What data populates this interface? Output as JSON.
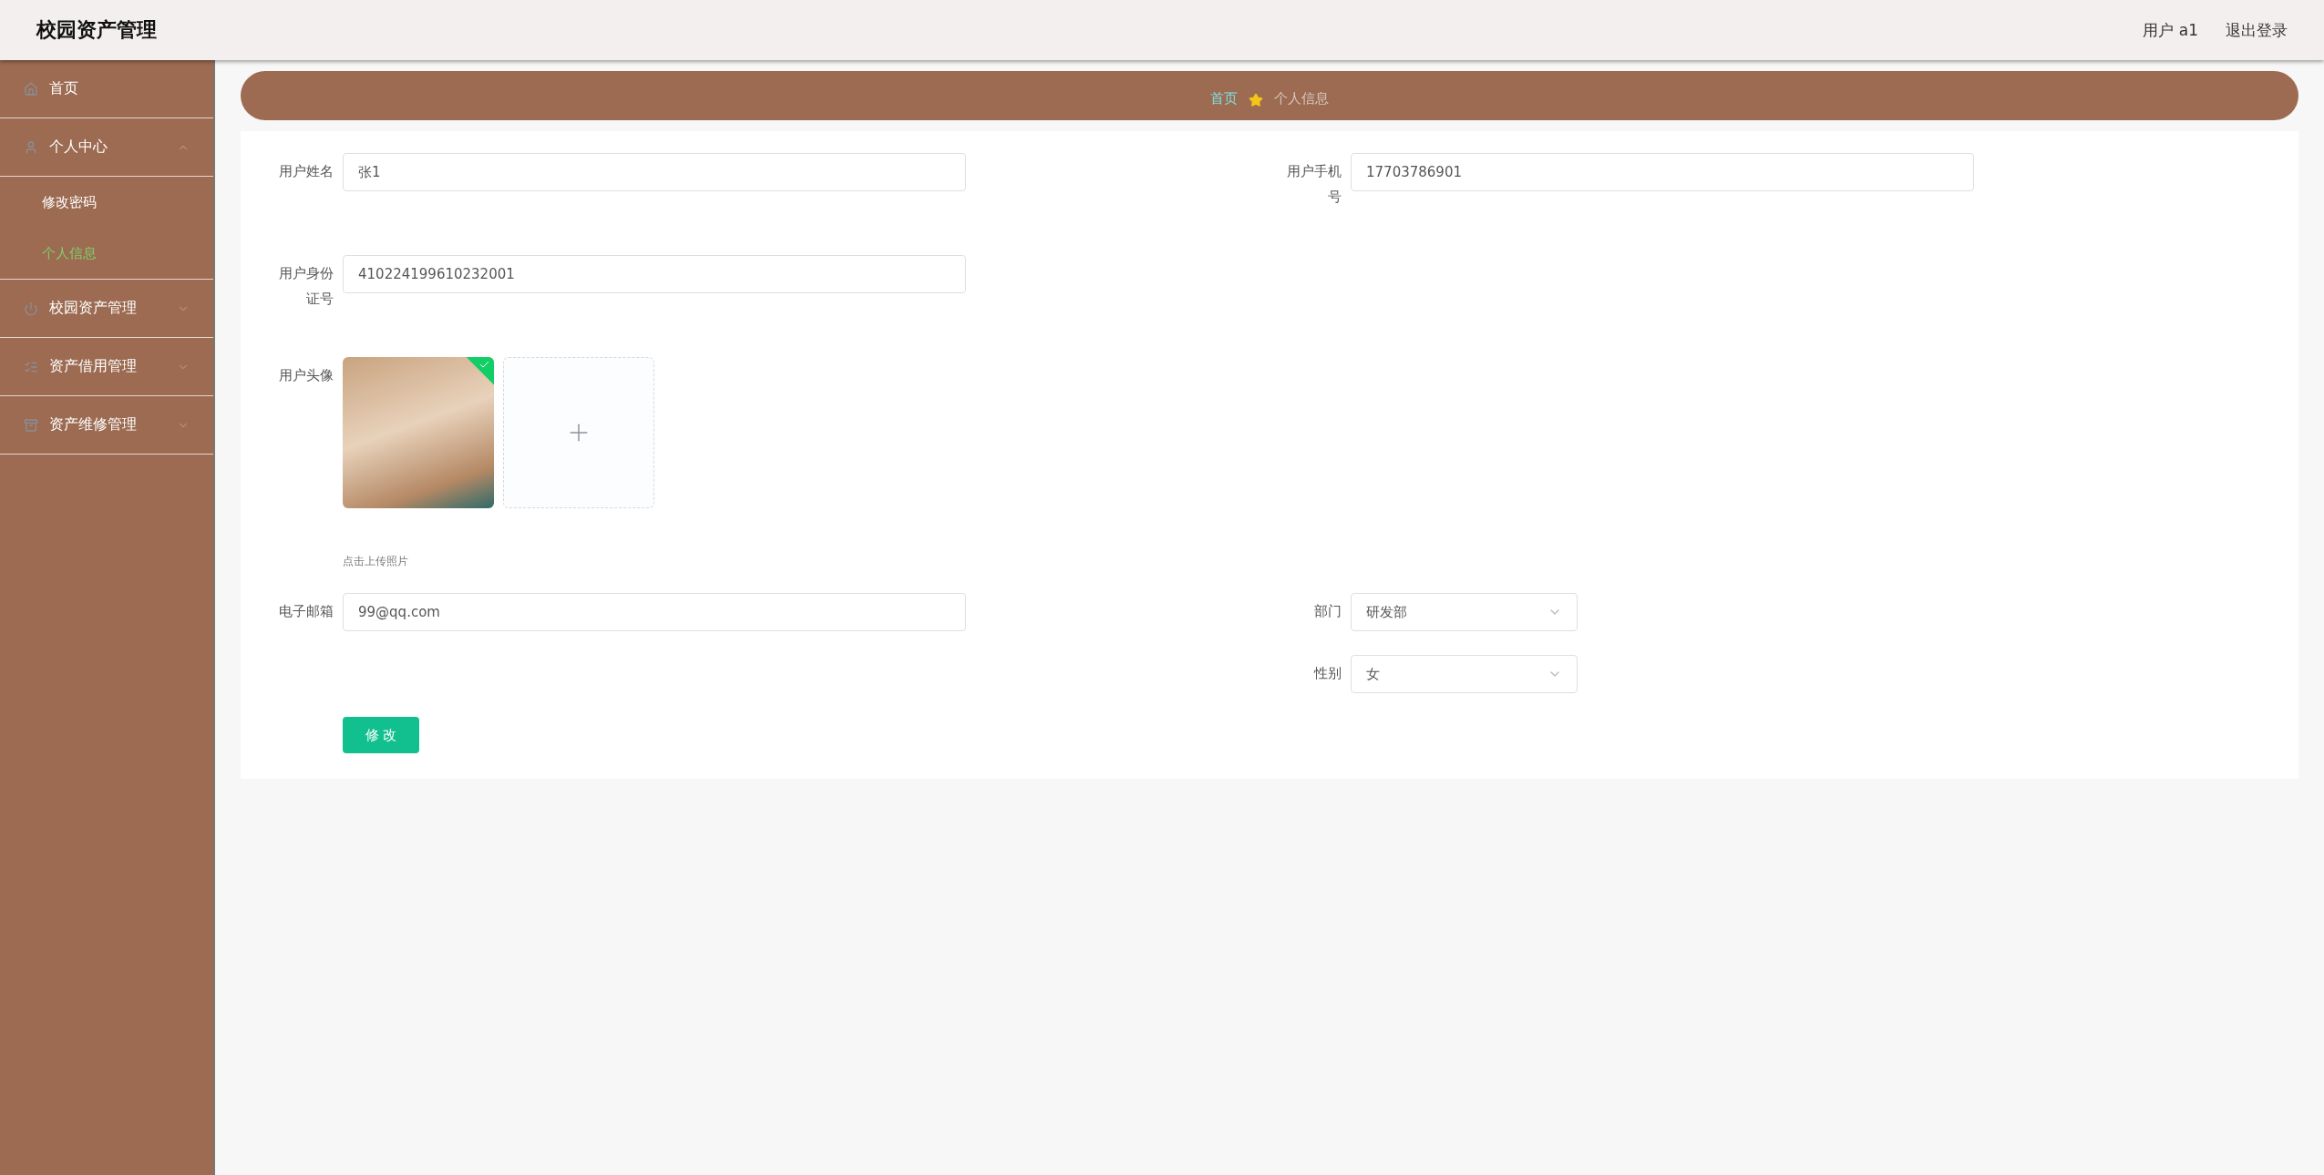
{
  "header": {
    "title": "校园资产管理",
    "user": "用户 a1",
    "logout": "退出登录"
  },
  "sidebar": {
    "items": [
      {
        "label": "首页"
      },
      {
        "label": "个人中心",
        "expanded": true,
        "children": [
          {
            "label": "修改密码",
            "selected": false
          },
          {
            "label": "个人信息",
            "selected": true
          }
        ]
      },
      {
        "label": "校园资产管理",
        "expanded": false
      },
      {
        "label": "资产借用管理",
        "expanded": false
      },
      {
        "label": "资产维修管理",
        "expanded": false
      }
    ]
  },
  "breadcrumb": {
    "home": "首页",
    "current": "个人信息"
  },
  "form": {
    "rows": [
      {
        "left": {
          "kind": "input",
          "label": "用户姓名",
          "value": "张1"
        },
        "right": {
          "kind": "input",
          "label": "用户手机号",
          "value": "17703786901"
        }
      },
      {
        "left": {
          "kind": "input",
          "label": "用户身份证号",
          "value": "410224199610232001"
        }
      },
      {
        "left": {
          "kind": "avatar",
          "label": "用户头像",
          "uploaded": true,
          "hint": "点击上传照片"
        }
      },
      {
        "left": {
          "kind": "input",
          "label": "电子邮箱",
          "value": "99@qq.com"
        },
        "right": {
          "kind": "select",
          "label": "部门",
          "value": "研发部"
        }
      },
      {
        "right": {
          "kind": "select",
          "label": "性别",
          "value": "女"
        }
      }
    ],
    "submit": "修 改"
  }
}
